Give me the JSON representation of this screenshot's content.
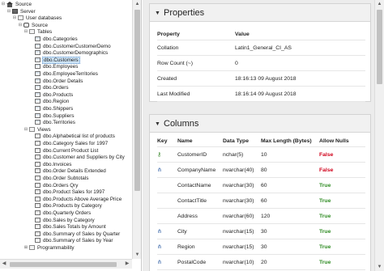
{
  "tree": {
    "nodes": [
      {
        "label": "Source",
        "icon": "home",
        "toggle": "⊟",
        "level": 0
      },
      {
        "label": "Server",
        "icon": "server",
        "toggle": "⊟",
        "level": 1
      },
      {
        "label": "User databases",
        "icon": "folder",
        "toggle": "⊟",
        "level": 2
      },
      {
        "label": "Source",
        "icon": "database",
        "toggle": "⊟",
        "level": 3
      },
      {
        "label": "Tables",
        "icon": "folder",
        "toggle": "⊟",
        "level": 4
      },
      {
        "label": "dbo.Categories",
        "icon": "table",
        "toggle": "",
        "level": 5
      },
      {
        "label": "dbo.CustomerCustomerDemo",
        "icon": "table",
        "toggle": "",
        "level": 5
      },
      {
        "label": "dbo.CustomerDemographics",
        "icon": "table",
        "toggle": "",
        "level": 5
      },
      {
        "label": "dbo.Customers",
        "icon": "table",
        "toggle": "",
        "level": 5,
        "selected": true
      },
      {
        "label": "dbo.Employees",
        "icon": "table",
        "toggle": "",
        "level": 5
      },
      {
        "label": "dbo.EmployeeTerritories",
        "icon": "table",
        "toggle": "",
        "level": 5
      },
      {
        "label": "dbo.Order Details",
        "icon": "table",
        "toggle": "",
        "level": 5
      },
      {
        "label": "dbo.Orders",
        "icon": "table",
        "toggle": "",
        "level": 5
      },
      {
        "label": "dbo.Products",
        "icon": "table",
        "toggle": "",
        "level": 5
      },
      {
        "label": "dbo.Region",
        "icon": "table",
        "toggle": "",
        "level": 5
      },
      {
        "label": "dbo.Shippers",
        "icon": "table",
        "toggle": "",
        "level": 5
      },
      {
        "label": "dbo.Suppliers",
        "icon": "table",
        "toggle": "",
        "level": 5
      },
      {
        "label": "dbo.Territories",
        "icon": "table",
        "toggle": "",
        "level": 5
      },
      {
        "label": "Views",
        "icon": "folder",
        "toggle": "⊟",
        "level": 4
      },
      {
        "label": "dbo.Alphabetical list of products",
        "icon": "view",
        "toggle": "",
        "level": 5
      },
      {
        "label": "dbo.Category Sales for 1997",
        "icon": "view",
        "toggle": "",
        "level": 5
      },
      {
        "label": "dbo.Current Product List",
        "icon": "view",
        "toggle": "",
        "level": 5
      },
      {
        "label": "dbo.Customer and Suppliers by City",
        "icon": "view",
        "toggle": "",
        "level": 5
      },
      {
        "label": "dbo.Invoices",
        "icon": "view",
        "toggle": "",
        "level": 5
      },
      {
        "label": "dbo.Order Details Extended",
        "icon": "view",
        "toggle": "",
        "level": 5
      },
      {
        "label": "dbo.Order Subtotals",
        "icon": "view",
        "toggle": "",
        "level": 5
      },
      {
        "label": "dbo.Orders Qry",
        "icon": "view",
        "toggle": "",
        "level": 5
      },
      {
        "label": "dbo.Product Sales for 1997",
        "icon": "view",
        "toggle": "",
        "level": 5
      },
      {
        "label": "dbo.Products Above Average Price",
        "icon": "view",
        "toggle": "",
        "level": 5
      },
      {
        "label": "dbo.Products by Category",
        "icon": "view",
        "toggle": "",
        "level": 5
      },
      {
        "label": "dbo.Quarterly Orders",
        "icon": "view",
        "toggle": "",
        "level": 5
      },
      {
        "label": "dbo.Sales by Category",
        "icon": "view",
        "toggle": "",
        "level": 5
      },
      {
        "label": "dbo.Sales Totals by Amount",
        "icon": "view",
        "toggle": "",
        "level": 5
      },
      {
        "label": "dbo.Summary of Sales by Quarter",
        "icon": "view",
        "toggle": "",
        "level": 5
      },
      {
        "label": "dbo.Summary of Sales by Year",
        "icon": "view",
        "toggle": "",
        "level": 5
      },
      {
        "label": "Programmability",
        "icon": "folder",
        "toggle": "⊞",
        "level": 4
      }
    ]
  },
  "properties": {
    "title": "Properties",
    "headers": {
      "property": "Property",
      "value": "Value"
    },
    "rows": [
      {
        "property": "Collation",
        "value": "Latin1_General_CI_AS"
      },
      {
        "property": "Row Count (~)",
        "value": "0"
      },
      {
        "property": "Created",
        "value": "18:16:13 09 August 2018"
      },
      {
        "property": "Last Modified",
        "value": "18:16:14 09 August 2018"
      }
    ]
  },
  "columns": {
    "title": "Columns",
    "headers": {
      "key": "Key",
      "name": "Name",
      "type": "Data Type",
      "maxlen": "Max Length (Bytes)",
      "allow": "Allow Nulls"
    },
    "rows": [
      {
        "key": "primary-key-icon",
        "name": "CustomerID",
        "type": "nchar(5)",
        "maxlen": "10",
        "allow": "False"
      },
      {
        "key": "index-icon",
        "name": "CompanyName",
        "type": "nvarchar(40)",
        "maxlen": "80",
        "allow": "False"
      },
      {
        "key": "",
        "name": "ContactName",
        "type": "nvarchar(30)",
        "maxlen": "60",
        "allow": "True"
      },
      {
        "key": "",
        "name": "ContactTitle",
        "type": "nvarchar(30)",
        "maxlen": "60",
        "allow": "True"
      },
      {
        "key": "",
        "name": "Address",
        "type": "nvarchar(60)",
        "maxlen": "120",
        "allow": "True"
      },
      {
        "key": "index-icon",
        "name": "City",
        "type": "nvarchar(15)",
        "maxlen": "30",
        "allow": "True"
      },
      {
        "key": "index-icon",
        "name": "Region",
        "type": "nvarchar(15)",
        "maxlen": "30",
        "allow": "True"
      },
      {
        "key": "index-icon",
        "name": "PostalCode",
        "type": "nvarchar(10)",
        "maxlen": "20",
        "allow": "True"
      }
    ]
  },
  "colors": {
    "false_text": "#d0021b",
    "true_text": "#2e8b22",
    "selection": "#cfe5f7",
    "panel_bg": "#ececec"
  }
}
